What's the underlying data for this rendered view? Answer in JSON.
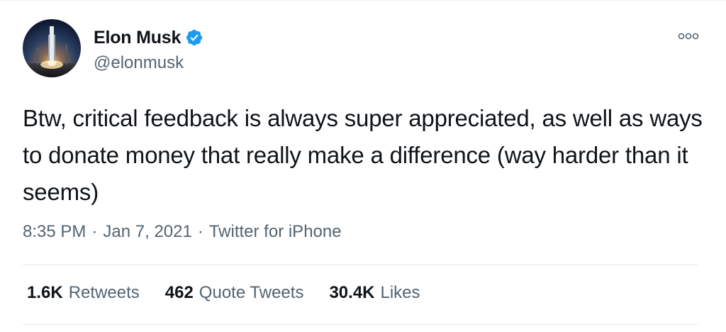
{
  "tweet": {
    "author": {
      "display_name": "Elon Musk",
      "handle": "@elonmusk",
      "verified": true,
      "verified_color": "#1d9bf0",
      "avatar_icon": "rocket-launch-avatar"
    },
    "text": "Btw, critical feedback is always super appreciated, as well as ways to donate money that really make a difference (way harder than it seems)",
    "time": "8:35 PM",
    "date": "Jan 7, 2021",
    "source": "Twitter for iPhone",
    "separator": "·",
    "stats": [
      {
        "value": "1.6K",
        "label": "Retweets"
      },
      {
        "value": "462",
        "label": "Quote Tweets"
      },
      {
        "value": "30.4K",
        "label": "Likes"
      }
    ]
  },
  "colors": {
    "text_primary": "#0f1419",
    "text_secondary": "#536471",
    "divider": "#e1e8ed"
  }
}
